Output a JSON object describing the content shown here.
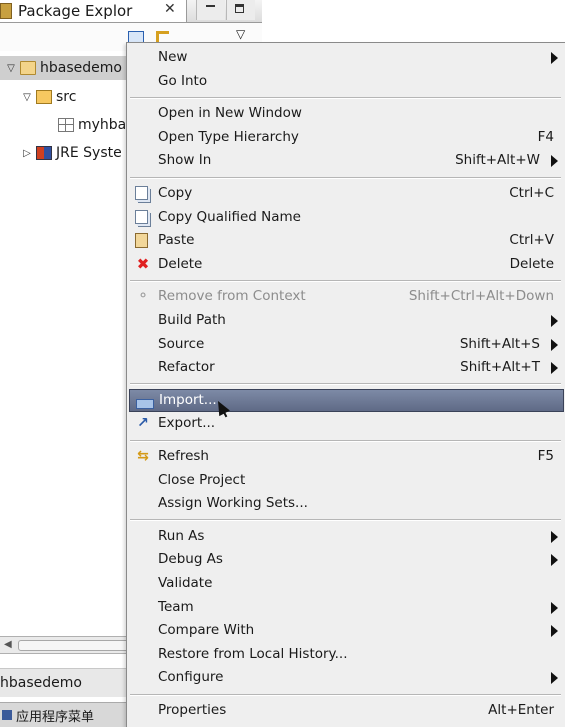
{
  "view": {
    "tab_title": "Package Explor",
    "close_glyph": "✕",
    "tree": [
      {
        "label": "hbasedemo",
        "icon": "project-icon",
        "twisty": "expanded",
        "selected": true
      },
      {
        "label": "src",
        "icon": "source-folder-icon",
        "twisty": "expanded",
        "selected": false
      },
      {
        "label": "myhba",
        "icon": "package-icon",
        "twisty": "none",
        "selected": false
      },
      {
        "label": "JRE Syste",
        "icon": "jre-library-icon",
        "twisty": "collapsed",
        "selected": false
      }
    ],
    "status_text": "hbasedemo",
    "taskbar_label": "应用程序菜单"
  },
  "context_menu": {
    "groups": [
      [
        {
          "label": "New",
          "accel": "",
          "submenu": true
        },
        {
          "label": "Go Into",
          "accel": "",
          "submenu": false
        }
      ],
      [
        {
          "label": "Open in New Window",
          "accel": "",
          "submenu": false
        },
        {
          "label": "Open Type Hierarchy",
          "accel": "F4",
          "submenu": false
        },
        {
          "label": "Show In",
          "accel": "Shift+Alt+W",
          "submenu": true
        }
      ],
      [
        {
          "label": "Copy",
          "accel": "Ctrl+C",
          "icon": "copy-icon"
        },
        {
          "label": "Copy Qualified Name",
          "accel": "",
          "icon": "copy-qualified-icon"
        },
        {
          "label": "Paste",
          "accel": "Ctrl+V",
          "icon": "paste-icon"
        },
        {
          "label": "Delete",
          "accel": "Delete",
          "icon": "delete-icon"
        }
      ],
      [
        {
          "label": "Remove from Context",
          "accel": "Shift+Ctrl+Alt+Down",
          "icon": "remove-context-icon",
          "disabled": true
        },
        {
          "label": "Build Path",
          "accel": "",
          "submenu": true
        },
        {
          "label": "Source",
          "accel": "Shift+Alt+S",
          "submenu": true
        },
        {
          "label": "Refactor",
          "accel": "Shift+Alt+T",
          "submenu": true
        }
      ],
      [
        {
          "label": "Import...",
          "accel": "",
          "icon": "import-icon",
          "highlighted": true
        },
        {
          "label": "Export...",
          "accel": "",
          "icon": "export-icon"
        }
      ],
      [
        {
          "label": "Refresh",
          "accel": "F5",
          "icon": "refresh-icon"
        },
        {
          "label": "Close Project",
          "accel": ""
        },
        {
          "label": "Assign Working Sets...",
          "accel": ""
        }
      ],
      [
        {
          "label": "Run As",
          "accel": "",
          "submenu": true
        },
        {
          "label": "Debug As",
          "accel": "",
          "submenu": true
        },
        {
          "label": "Validate",
          "accel": ""
        },
        {
          "label": "Team",
          "accel": "",
          "submenu": true
        },
        {
          "label": "Compare With",
          "accel": "",
          "submenu": true
        },
        {
          "label": "Restore from Local History...",
          "accel": ""
        },
        {
          "label": "Configure",
          "accel": "",
          "submenu": true
        }
      ],
      [
        {
          "label": "Properties",
          "accel": "Alt+Enter"
        }
      ]
    ]
  }
}
